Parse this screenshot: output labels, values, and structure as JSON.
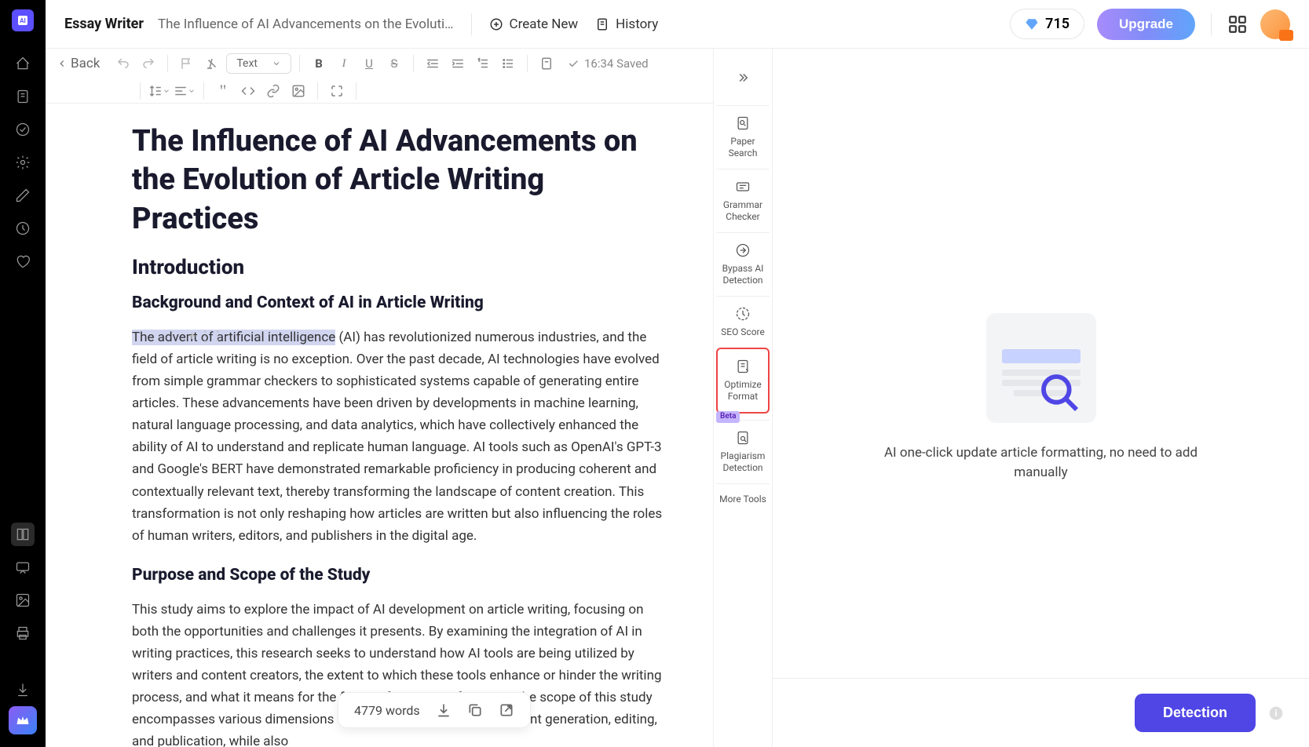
{
  "header": {
    "app_name": "Essay Writer",
    "doc_title": "The Influence of AI Advancements on the Evoluti…",
    "create_new": "Create New",
    "history": "History",
    "credits": "715",
    "upgrade": "Upgrade"
  },
  "toolbar": {
    "back": "Back",
    "text_style": "Text",
    "saved_time": "16:34 Saved"
  },
  "document": {
    "title": "The Influence of AI Advancements on the Evolution of Article Writing Practices",
    "h2_intro": "Introduction",
    "h3_background": "Background and Context of AI in Article Writing",
    "highlighted": "The advent of artificial intelligence",
    "p1_rest": " (AI) has revolutionized numerous industries, and the field of article writing is no exception. Over the past decade, AI technologies have evolved from simple grammar checkers to sophisticated systems capable of generating entire articles. These advancements have been driven by developments in machine learning, natural language processing, and data analytics, which have collectively enhanced the ability of AI to understand and replicate human language. AI tools such as OpenAI's GPT-3 and Google's BERT have demonstrated remarkable proficiency in producing coherent and contextually relevant text, thereby transforming the landscape of content creation. This transformation is not only reshaping how articles are written but also influencing the roles of human writers, editors, and publishers in the digital age.",
    "h3_purpose": "Purpose and Scope of the Study",
    "p2": "This study aims to explore the impact of AI development on article writing, focusing on both the opportunities and challenges it presents. By examining the integration of AI in writing practices, this research seeks to understand how AI tools are being utilized by writers and content creators, the extent to which these tools enhance or hinder the writing process, and what it means for the future of writing professions. The scope of this study encompasses various dimensions of article writing, including content generation, editing, and publication, while also"
  },
  "tools": {
    "paper_search": "Paper Search",
    "grammar": "Grammar Checker",
    "bypass": "Bypass AI Detection",
    "seo": "SEO Score",
    "optimize": "Optimize Format",
    "plagiarism": "Plagiarism Detection",
    "more": "More Tools",
    "beta": "Beta"
  },
  "right_panel": {
    "message": "AI one-click update article formatting, no need to add manually"
  },
  "footer": {
    "word_count": "4779 words",
    "detection": "Detection"
  }
}
